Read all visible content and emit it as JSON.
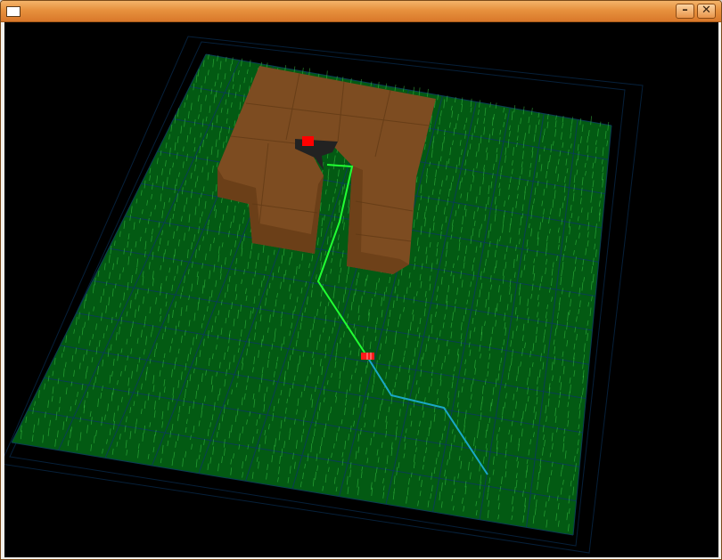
{
  "window": {
    "title": "",
    "minimize_label": "–",
    "close_label": "✕"
  },
  "scene": {
    "ground_color": "#035a13",
    "grid_color": "#0a3d55",
    "grass_color": "#3fcf4a",
    "obstacle_color": "#7b4a20",
    "path_near_color": "#22ff33",
    "path_far_color": "#1aa8c8",
    "agent_color": "#ff0000",
    "start_marker_color": "#ff1a1a"
  }
}
